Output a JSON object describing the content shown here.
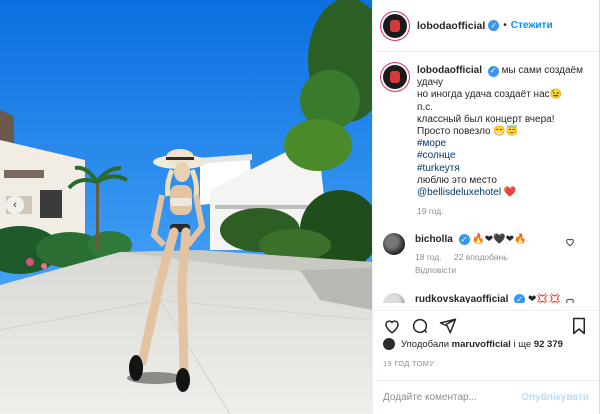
{
  "post": {
    "username": "lobodaofficial",
    "follow_label": "Стежити",
    "dot": "•",
    "caption_lines": [
      "мы сами создаём",
      "удачу",
      "но иногда удача создаёт нас😉",
      "п.с.",
      "классный был концерт вчера!",
      "Просто повезло 😁😇"
    ],
    "hashtags": [
      "#море",
      "#солнце",
      "#turkeyтя"
    ],
    "caption_tail": "люблю это место",
    "mention": "@bellisdeluxehotel",
    "mention_heart": "❤️",
    "caption_time": "19 год."
  },
  "comments": [
    {
      "username": "bicholla",
      "text": "🔥❤🖤❤🔥",
      "time": "18 год.",
      "likes": "22 вподобань",
      "reply_label": "Відповісти"
    },
    {
      "username": "rudkovskayaofficial",
      "text": "❤💢💢"
    }
  ],
  "likes_line": {
    "prefix": "Уподобали",
    "user": "maruvofficial",
    "suffix": "і ще",
    "count": "92 379"
  },
  "ago": "19 ГОД ТОМУ",
  "add_comment": {
    "placeholder": "Додайте коментар...",
    "publish_label": "Опублікувати"
  },
  "icons": {
    "verified": "✓",
    "carousel_prev": "‹"
  }
}
